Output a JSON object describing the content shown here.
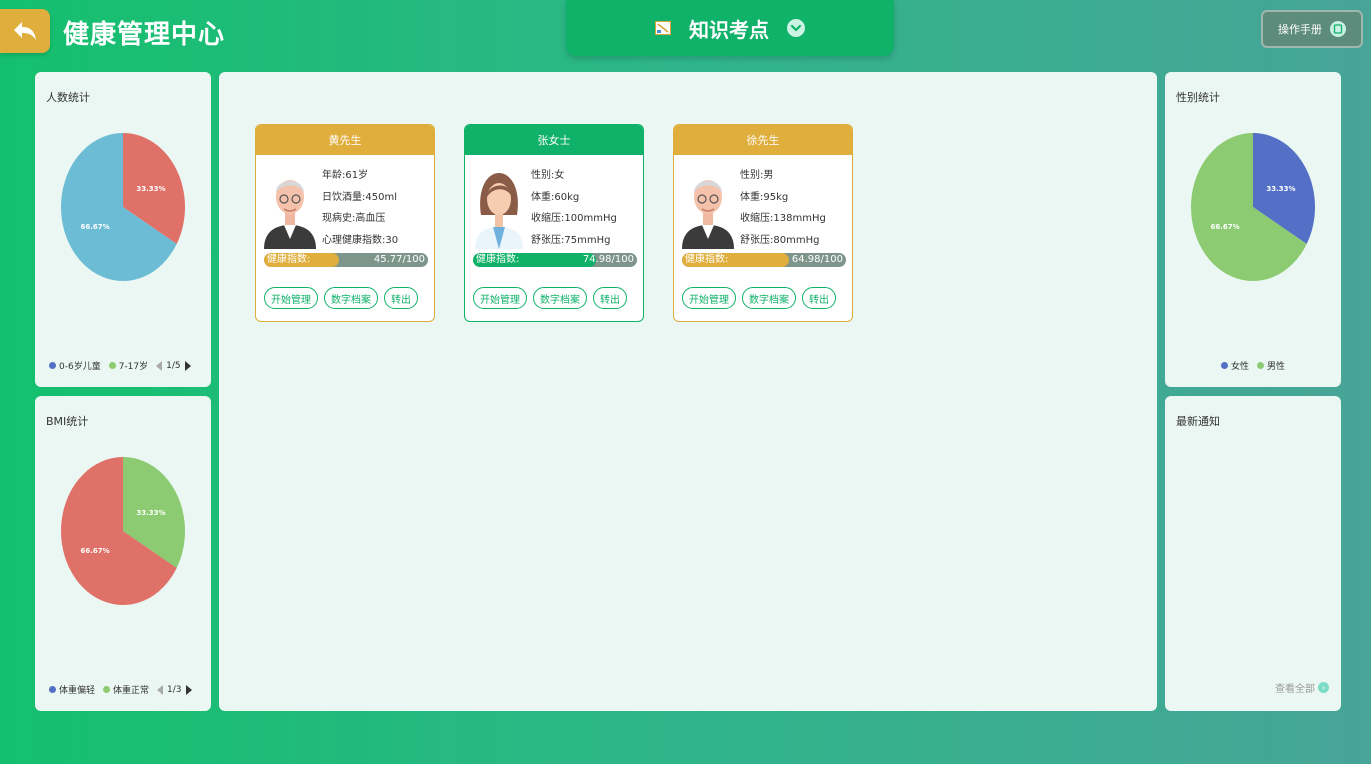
{
  "header": {
    "title": "健康管理中心",
    "tab_label": "知识考点",
    "manual_label": "操作手册"
  },
  "colors": {
    "gold": "#e0ae3c",
    "green": "#10b169",
    "pie_red": "#e07168",
    "pie_blue": "#6cbcd5",
    "pie_green": "#8ccb72",
    "pie_indigo": "#5470c6"
  },
  "panels": {
    "people": {
      "title": "人数统计",
      "chart_data": {
        "type": "pie",
        "slices": [
          {
            "label": "33.33%",
            "value": 33.33,
            "color": "#e07168"
          },
          {
            "label": "66.67%",
            "value": 66.67,
            "color": "#6cbcd5"
          }
        ]
      },
      "legend": [
        {
          "name": "0-6岁儿童",
          "color": "#5470c6"
        },
        {
          "name": "7-17岁",
          "color": "#8ccb72"
        }
      ],
      "page": "1/5"
    },
    "bmi": {
      "title": "BMI统计",
      "chart_data": {
        "type": "pie",
        "slices": [
          {
            "label": "33.33%",
            "value": 33.33,
            "color": "#8ccb72"
          },
          {
            "label": "66.67%",
            "value": 66.67,
            "color": "#e07168"
          }
        ]
      },
      "legend": [
        {
          "name": "体重偏轻",
          "color": "#5470c6"
        },
        {
          "name": "体重正常",
          "color": "#8ccb72"
        }
      ],
      "page": "1/3"
    },
    "gender": {
      "title": "性别统计",
      "chart_data": {
        "type": "pie",
        "slices": [
          {
            "label": "33.33%",
            "value": 33.33,
            "color": "#5470c6"
          },
          {
            "label": "66.67%",
            "value": 66.67,
            "color": "#8ccb72"
          }
        ]
      },
      "legend": [
        {
          "name": "女性",
          "color": "#5470c6"
        },
        {
          "name": "男性",
          "color": "#8ccb72"
        }
      ]
    },
    "notice": {
      "title": "最新通知",
      "view_all": "查看全部"
    }
  },
  "cards": [
    {
      "name": "黄先生",
      "theme": "#e0ae3c",
      "avatar": "elderly-man",
      "info": [
        "年龄:61岁",
        "日饮酒量:450ml",
        "现病史:高血压",
        "心理健康指数:30"
      ],
      "index_label": "健康指数:",
      "index_value": "45.77/100",
      "index": 45.77,
      "buttons": [
        "开始管理",
        "数字档案",
        "转出"
      ]
    },
    {
      "name": "张女士",
      "theme": "#10b169",
      "avatar": "woman",
      "info": [
        "性别:女",
        "体重:60kg",
        "收缩压:100mmHg",
        "舒张压:75mmHg"
      ],
      "index_label": "健康指数:",
      "index_value": "74.98/100",
      "index": 74.98,
      "buttons": [
        "开始管理",
        "数字档案",
        "转出"
      ]
    },
    {
      "name": "徐先生",
      "theme": "#e0ae3c",
      "avatar": "elderly-man",
      "info": [
        "性别:男",
        "体重:95kg",
        "收缩压:138mmHg",
        "舒张压:80mmHg"
      ],
      "index_label": "健康指数:",
      "index_value": "64.98/100",
      "index": 64.98,
      "buttons": [
        "开始管理",
        "数字档案",
        "转出"
      ]
    }
  ]
}
